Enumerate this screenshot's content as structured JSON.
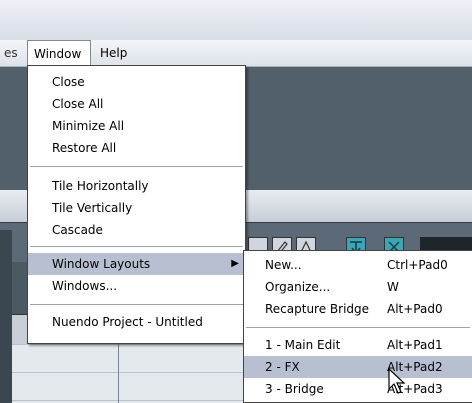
{
  "menubar": {
    "partial_left": "es",
    "window_label": "Window",
    "help_label": "Help"
  },
  "window_menu": {
    "items": [
      {
        "label": "Close"
      },
      {
        "label": "Close All"
      },
      {
        "label": "Minimize All"
      },
      {
        "label": "Restore All"
      },
      {
        "label": "Tile Horizontally"
      },
      {
        "label": "Tile Vertically"
      },
      {
        "label": "Cascade"
      },
      {
        "label": "Window Layouts"
      },
      {
        "label": "Windows..."
      },
      {
        "label": "Nuendo Project - Untitled"
      }
    ]
  },
  "layouts_submenu": {
    "items": [
      {
        "label": "New...",
        "shortcut": "Ctrl+Pad0"
      },
      {
        "label": "Organize...",
        "shortcut": "W"
      },
      {
        "label": "Recapture Bridge",
        "shortcut": "Alt+Pad0"
      },
      {
        "label": "1 - Main Edit",
        "shortcut": "Alt+Pad1"
      },
      {
        "label": "2 - FX",
        "shortcut": "Alt+Pad2"
      },
      {
        "label": "3 - Bridge",
        "shortcut": "Alt+Pad3"
      }
    ]
  },
  "colors": {
    "highlight": "#b7c0d0",
    "accent_teal": "#3aa6b6"
  }
}
